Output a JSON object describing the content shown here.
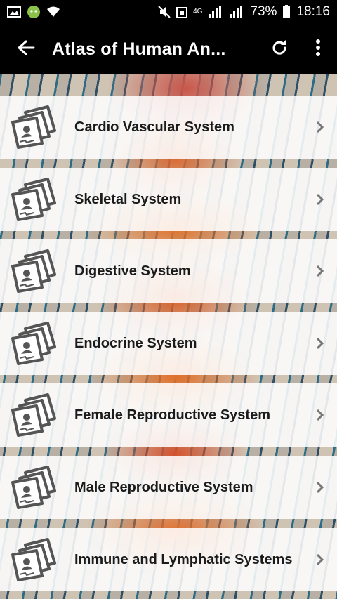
{
  "status_bar": {
    "battery": "73%",
    "time": "18:16",
    "network": "4G"
  },
  "toolbar": {
    "title": "Atlas of Human An...",
    "back_icon": "arrow-left-icon",
    "refresh_icon": "refresh-icon",
    "menu_icon": "more-vertical-icon"
  },
  "list": {
    "items": [
      {
        "label": "Cardio Vascular System"
      },
      {
        "label": "Skeletal System"
      },
      {
        "label": "Digestive System"
      },
      {
        "label": "Endocrine System"
      },
      {
        "label": "Female Reproductive System"
      },
      {
        "label": "Male Reproductive System"
      },
      {
        "label": "Immune and Lymphatic Systems"
      }
    ]
  }
}
